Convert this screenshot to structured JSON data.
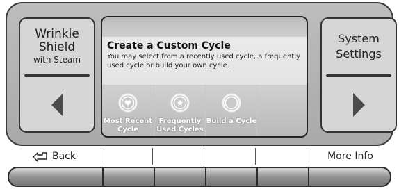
{
  "left_panel": {
    "title_line1": "Wrinkle",
    "title_line2": "Shield",
    "title_line3": "with Steam",
    "arrow_icon": "triangle-left-icon"
  },
  "right_panel": {
    "title_line1": "System",
    "title_line2": "Settings",
    "arrow_icon": "triangle-right-icon"
  },
  "screen": {
    "title": "Create a Custom Cycle",
    "description": "You may select from a recently used cycle, a frequently used cycle or build your own cycle.",
    "options": [
      {
        "line1": "Most Recent",
        "line2": "Cycle",
        "icon": "heart-cycle-icon"
      },
      {
        "line1": "Frequently",
        "line2": "Used Cycles",
        "icon": "star-cycle-icon"
      },
      {
        "line1": "Build a Cycle",
        "line2": "",
        "icon": "blank-cycle-icon"
      }
    ]
  },
  "bottom_bar": {
    "back_label": "Back",
    "back_icon": "back-arrow-icon",
    "more_info_label": "More Info"
  }
}
